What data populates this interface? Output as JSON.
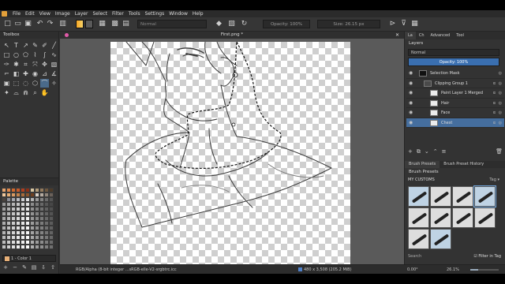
{
  "menu": [
    "File",
    "Edit",
    "View",
    "Image",
    "Layer",
    "Select",
    "Filter",
    "Tools",
    "Settings",
    "Window",
    "Help"
  ],
  "toolbar": {
    "blend_mode": "Normal",
    "opacity": "Opacity: 100%",
    "size": "Size: 26.15 px"
  },
  "toolbox": {
    "title": "Toolbox"
  },
  "palette": {
    "title": "Palette",
    "selected_color_name": "1 - Color 1",
    "colors": [
      "#e6a36c",
      "#e0884b",
      "#d0682c",
      "#c65a2a",
      "#b03e1f",
      "#8b2e15",
      "#d9c6a1",
      "#b39c79",
      "#937a5d",
      "#6d573e",
      "#4c3a28",
      "#f0c79b",
      "#e8b077",
      "#d99a62",
      "#c2834d",
      "#a86b3b",
      "#8a532c",
      "#6f4020",
      "#d9d1c8",
      "#b5aba1",
      "#8f857b",
      "#6a615a",
      "#4a433e",
      "#8e9098",
      "#a6a8ae",
      "#babcc1",
      "#cdced2",
      "#e0e1e3",
      "#b3b3b3",
      "#9a9a9a",
      "#828282",
      "#6b6b6b",
      "#555555",
      "#9a9a9a",
      "#a8a8a8",
      "#b6b6b6",
      "#c4c4c4",
      "#d2d2d2",
      "#e0e0e0",
      "#8c8c8c",
      "#7a7a7a",
      "#686868",
      "#575757",
      "#474747",
      "#a0a0a0",
      "#b0b0b0",
      "#c0c0c0",
      "#d0d0d0",
      "#dedede",
      "#ececec",
      "#909090",
      "#808080",
      "#707070",
      "#606060",
      "#505050",
      "#a4a4a4",
      "#b4b4b4",
      "#c4c4c4",
      "#d4d4d4",
      "#e2e2e2",
      "#eeeeee",
      "#949494",
      "#848484",
      "#747474",
      "#646464",
      "#545454",
      "#a8a8a8",
      "#b8b8b8",
      "#c8c8c8",
      "#d8d8d8",
      "#e4e4e4",
      "#f0f0f0",
      "#989898",
      "#888888",
      "#787878",
      "#686868",
      "#585858",
      "#acacac",
      "#bcbcbc",
      "#cccccc",
      "#dcdcdc",
      "#e6e6e6",
      "#f2f2f2",
      "#9c9c9c",
      "#8c8c8c",
      "#7c7c7c",
      "#6c6c6c",
      "#5c5c5c",
      "#b0b0b0",
      "#c0c0c0",
      "#d0d0d0",
      "#e0e0e0",
      "#e8e8e8",
      "#f4f4f4",
      "#a0a0a0",
      "#909090",
      "#808080",
      "#707070",
      "#606060",
      "#b4b4b4",
      "#c4c4c4",
      "#d4d4d4",
      "#e4e4e4",
      "#eaeaea",
      "#f6f6f6",
      "#a4a4a4",
      "#949494",
      "#848484",
      "#747474",
      "#646464",
      "#b8b8b8",
      "#c8c8c8",
      "#d8d8d8",
      "#e8e8e8",
      "#ececec",
      "#f8f8f8",
      "#a8a8a8",
      "#989898",
      "#888888",
      "#787878",
      "#686868",
      "#bcbcbc",
      "#cccccc",
      "#dcdcdc",
      "#ececec",
      "#eeeeee",
      "#fafafa",
      "#acacac",
      "#9c9c9c",
      "#8c8c8c",
      "#7c7c7c",
      "#6c6c6c",
      "#c0c0c0",
      "#d0d0d0",
      "#e0e0e0",
      "#f0f0f0",
      "#f0f0f0",
      "#fcfcfc",
      "#b0b0b0",
      "#a0a0a0",
      "#909090",
      "#808080",
      "#707070"
    ]
  },
  "document": {
    "tab_title": "First.png *"
  },
  "status": {
    "color_space": "RGB/Alpha (8-bit integer ...sRGB-elle-V2-srgbtrc.icc",
    "dimensions": "480 x 3,508 (205.2 MiB)",
    "rotation": "0.00°",
    "zoom": "26.1%"
  },
  "docker": {
    "tabs": [
      "La",
      "Ch",
      "Advanced",
      "Tool"
    ],
    "layers_title": "Layers",
    "blend_mode": "Normal",
    "opacity": "Opacity: 100%",
    "layers": [
      {
        "name": "Selection Mask",
        "indent": 0,
        "selected": false
      },
      {
        "name": "Clipping Group 1",
        "indent": 1,
        "selected": false
      },
      {
        "name": "Paint Layer 1 Merged",
        "indent": 2,
        "selected": false
      },
      {
        "name": "Hair",
        "indent": 2,
        "selected": false
      },
      {
        "name": "Face",
        "indent": 2,
        "selected": false
      },
      {
        "name": "Chest",
        "indent": 2,
        "selected": true
      }
    ]
  },
  "brush_presets": {
    "tabs": [
      "Brush Presets",
      "Brush Preset History"
    ],
    "title": "Brush Presets",
    "filter": "MY CUSTOMS",
    "tag_label": "Tag",
    "search_placeholder": "Search",
    "filter_in_tag": "Filter in Tag"
  }
}
